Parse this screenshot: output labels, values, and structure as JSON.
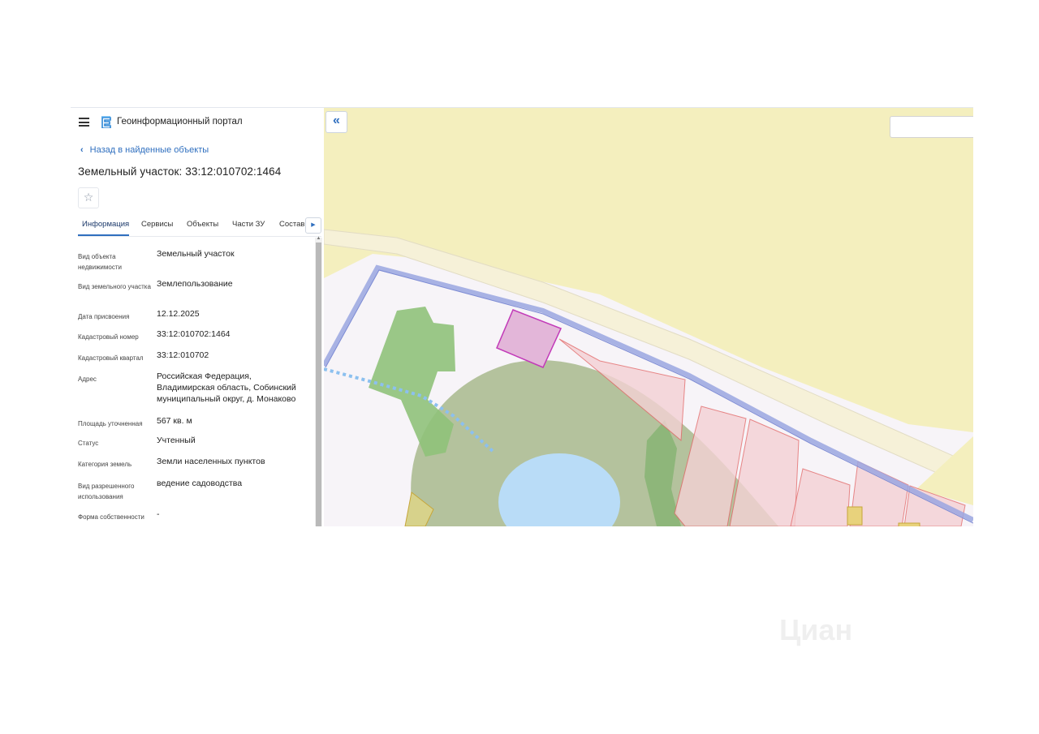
{
  "header": {
    "portal_title": "Геоинформационный портал"
  },
  "back_link": "Назад в найденные объекты",
  "object_title": "Земельный участок: 33:12:010702:1464",
  "tabs": [
    {
      "label": "Информация",
      "active": true
    },
    {
      "label": "Сервисы",
      "active": false
    },
    {
      "label": "Объекты",
      "active": false
    },
    {
      "label": "Части ЗУ",
      "active": false
    },
    {
      "label": "Состав",
      "active": false
    }
  ],
  "info": [
    {
      "label": "Вид объекта недвижимости",
      "value": "Земельный участок"
    },
    {
      "label": "Вид земельного участка",
      "value": "Землепользование"
    },
    {
      "label": "Дата присвоения",
      "value": "12.12.2025"
    },
    {
      "label": "Кадастровый номер",
      "value": "33:12:010702:1464"
    },
    {
      "label": "Кадастровый квартал",
      "value": "33:12:010702"
    },
    {
      "label": "Адрес",
      "value": "Российская Федерация, Владимирская область, Собинский муниципальный округ, д. Монаково"
    },
    {
      "label": "Площадь уточненная",
      "value": "567 кв. м"
    },
    {
      "label": "Статус",
      "value": "Учтенный"
    },
    {
      "label": "Категория земель",
      "value": "Земли населенных пунктов"
    },
    {
      "label": "Вид разрешенного использования",
      "value": "ведение садоводства"
    },
    {
      "label": "Форма собственности",
      "value": "-"
    }
  ],
  "icons": {
    "menu": "menu-icon",
    "logo": "portal-logo-icon",
    "back": "chevron-left-icon",
    "favorite": "star-icon",
    "tabs_more": "chevron-right-icon",
    "collapse": "double-chevron-left-icon"
  },
  "colors": {
    "accent": "#2f6fbf",
    "selected_parcel": "#c23ab8",
    "parcel_outline": "#e36a6a",
    "road": "#9aa6e0",
    "water": "#b9dcf7",
    "forest": "#8fc27a",
    "map_background": "#f4efbe"
  },
  "watermark": "Циан"
}
